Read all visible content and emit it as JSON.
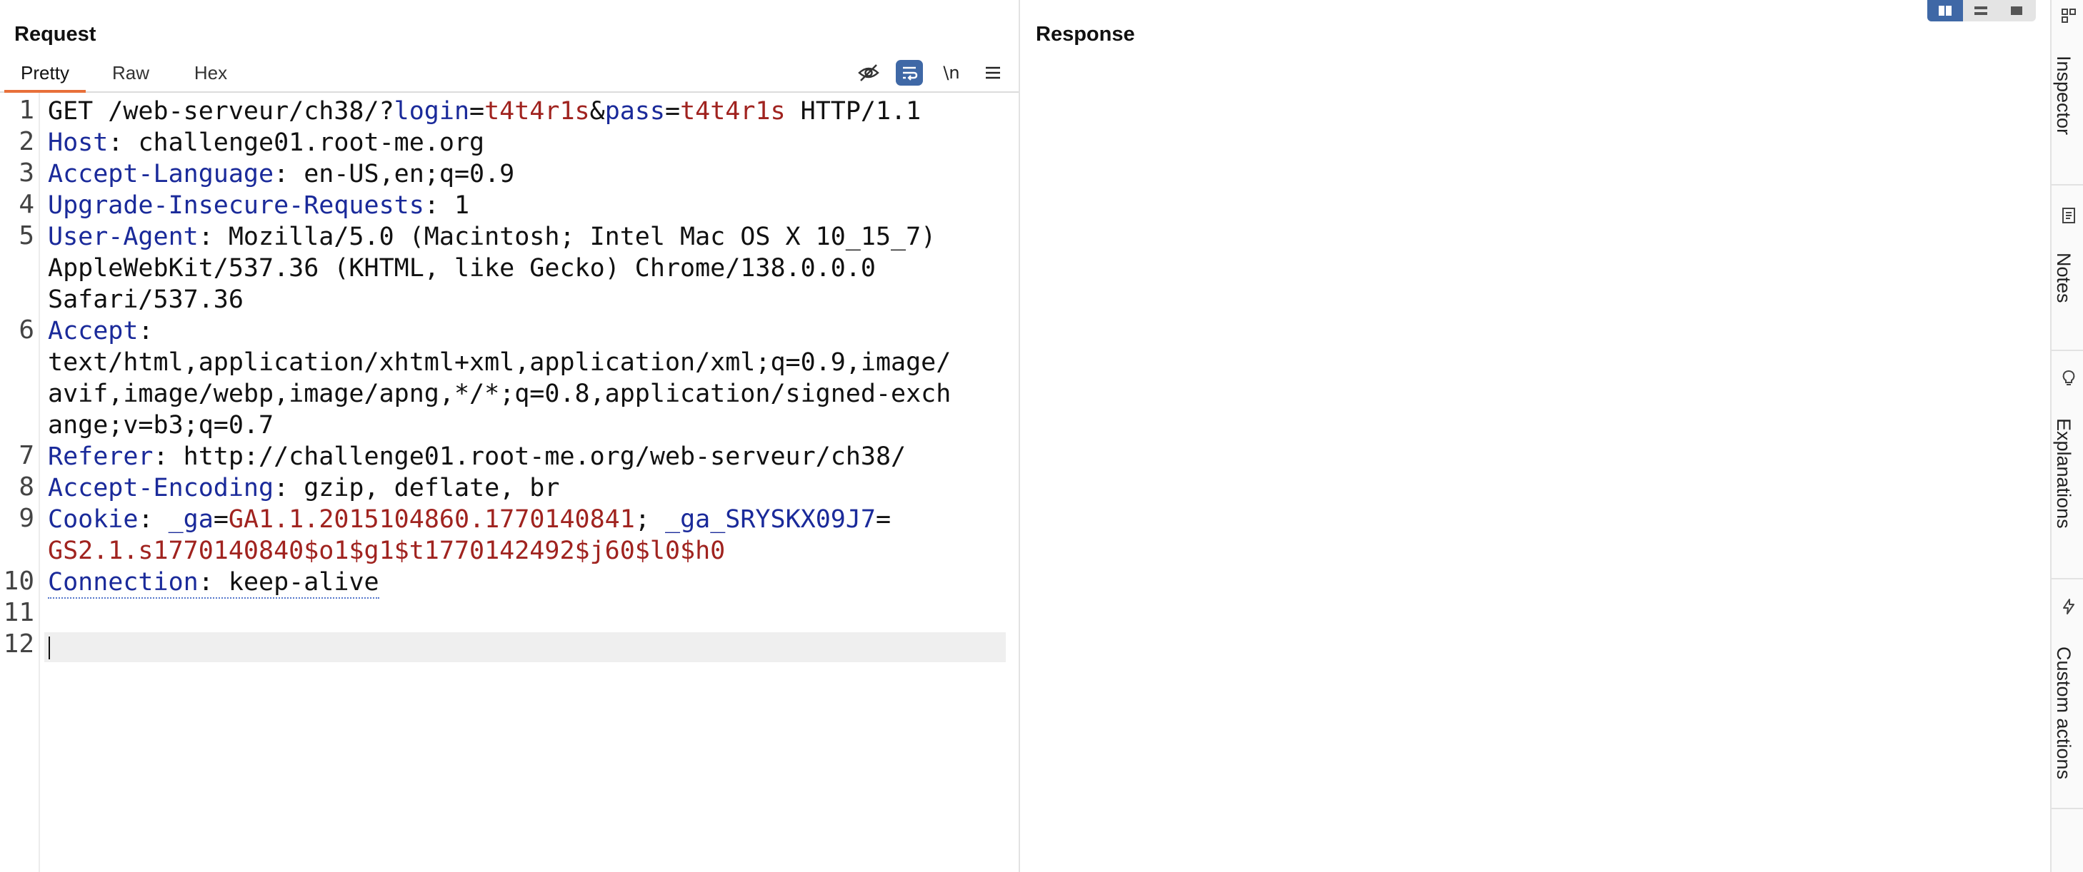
{
  "request": {
    "title": "Request",
    "tabs": [
      "Pretty",
      "Raw",
      "Hex"
    ],
    "active_tab": "Pretty",
    "toolbar": {
      "newline_label": "\\n"
    },
    "line_numbers": [
      "1",
      "2",
      "3",
      "4",
      "5",
      "6",
      "7",
      "8",
      "9",
      "10",
      "11",
      "12"
    ],
    "lines": {
      "l1": {
        "method_path": "GET /web-serveur/ch38/?",
        "p1_key": "login",
        "eq1": "=",
        "p1_val": "t4t4r1s",
        "amp": "&",
        "p2_key": "pass",
        "eq2": "=",
        "p2_val": "t4t4r1s",
        "proto": " HTTP/1.1"
      },
      "l2": {
        "key": "Host",
        "val": ": challenge01.root-me.org"
      },
      "l3": {
        "key": "Accept-Language",
        "val": ": en-US,en;q=0.9"
      },
      "l4": {
        "key": "Upgrade-Insecure-Requests",
        "val": ": 1"
      },
      "l5": {
        "key": "User-Agent",
        "val": ": Mozilla/5.0 (Macintosh; Intel Mac OS X 10_15_7)",
        "cont1": "AppleWebKit/537.36 (KHTML, like Gecko) Chrome/138.0.0.0",
        "cont2": "Safari/537.36"
      },
      "l6": {
        "key": "Accept",
        "val": ":",
        "cont1": "text/html,application/xhtml+xml,application/xml;q=0.9,image/",
        "cont2": "avif,image/webp,image/apng,*/*;q=0.8,application/signed-exch",
        "cont3": "ange;v=b3;q=0.7"
      },
      "l7": {
        "key": "Referer",
        "val": ": http://challenge01.root-me.org/web-serveur/ch38/"
      },
      "l8": {
        "key": "Accept-Encoding",
        "val": ": gzip, deflate, br"
      },
      "l9": {
        "key": "Cookie",
        "sep": ": ",
        "c1_key": "_ga",
        "c1_eq": "=",
        "c1_val": "GA1.1.2015104860.1770140841",
        "c_sep": "; ",
        "c2_key": "_ga_SRYSKX09J7",
        "c2_eq": "=",
        "c2_val": "GS2.1.s1770140840$o1$g1$t1770142492$j60$l0$h0"
      },
      "l10": {
        "key": "Connection",
        "sep": ": ",
        "val": "keep-alive"
      }
    }
  },
  "response": {
    "title": "Response"
  },
  "side_rail": {
    "items": [
      "Inspector",
      "Notes",
      "Explanations",
      "Custom actions"
    ]
  },
  "colors": {
    "accent_tab": "#e8703a",
    "header_key": "#1a2a9a",
    "value_red": "#a0231f",
    "active_blue": "#3f68a6"
  },
  "icons": [
    "eye-off-icon",
    "wrap-lines-icon",
    "menu-icon",
    "layout-split-icon",
    "layout-rows-icon",
    "layout-single-icon",
    "inspector-icon",
    "notes-icon",
    "lightbulb-icon",
    "lightning-icon"
  ]
}
